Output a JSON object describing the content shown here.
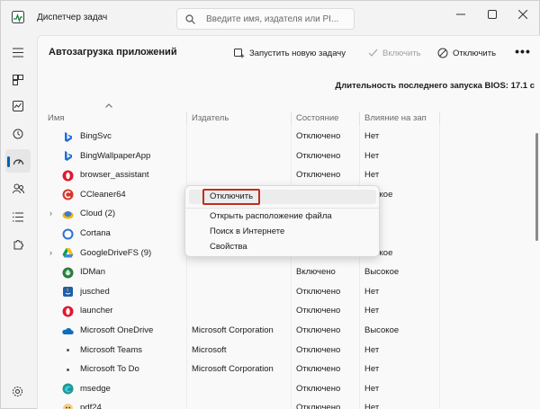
{
  "window": {
    "title": "Диспетчер задач",
    "search_placeholder": "Введите имя, издателя или PI..."
  },
  "page": {
    "title": "Автозагрузка приложений",
    "bios_label": "Длительность последнего запуска BIOS: 17.1 с"
  },
  "toolbar": {
    "run_new_task": "Запустить новую задачу",
    "enable": "Включить",
    "disable": "Отключить",
    "more": "•••"
  },
  "columns": {
    "name": "Имя",
    "publisher": "Издатель",
    "status": "Состояние",
    "impact": "Влияние на зап"
  },
  "rows": [
    {
      "name": "BingSvc",
      "publisher": "",
      "status": "Отключено",
      "impact": "Нет",
      "icon": "bing-icon",
      "expander": ""
    },
    {
      "name": "BingWallpaperApp",
      "publisher": "",
      "status": "Отключено",
      "impact": "Нет",
      "icon": "bing-icon",
      "expander": ""
    },
    {
      "name": "browser_assistant",
      "publisher": "",
      "status": "Отключено",
      "impact": "Нет",
      "icon": "opera-icon",
      "expander": ""
    },
    {
      "name": "CCleaner64",
      "publisher": "",
      "status": "Включено",
      "impact": "Низкое",
      "icon": "ccleaner-icon",
      "expander": ""
    },
    {
      "name": "Cloud (2)",
      "publisher": "",
      "status": "",
      "impact": "",
      "icon": "cloud-icon",
      "expander": "›"
    },
    {
      "name": "Cortana",
      "publisher": "",
      "status": "",
      "impact": "",
      "icon": "cortana-icon",
      "expander": ""
    },
    {
      "name": "GoogleDriveFS (9)",
      "publisher": "",
      "status": "",
      "impact": "Низкое",
      "icon": "google-drive-icon",
      "expander": "›"
    },
    {
      "name": "IDMan",
      "publisher": "",
      "status": "Включено",
      "impact": "Высокое",
      "icon": "idm-icon",
      "expander": ""
    },
    {
      "name": "jusched",
      "publisher": "",
      "status": "Отключено",
      "impact": "Нет",
      "icon": "java-icon",
      "expander": ""
    },
    {
      "name": "launcher",
      "publisher": "",
      "status": "Отключено",
      "impact": "Нет",
      "icon": "opera-icon",
      "expander": ""
    },
    {
      "name": "Microsoft OneDrive",
      "publisher": "Microsoft Corporation",
      "status": "Отключено",
      "impact": "Высокое",
      "icon": "onedrive-icon",
      "expander": ""
    },
    {
      "name": "Microsoft Teams",
      "publisher": "Microsoft",
      "status": "Отключено",
      "impact": "Нет",
      "icon": "teams-icon",
      "expander": ""
    },
    {
      "name": "Microsoft To Do",
      "publisher": "Microsoft Corporation",
      "status": "Отключено",
      "impact": "Нет",
      "icon": "todo-icon",
      "expander": ""
    },
    {
      "name": "msedge",
      "publisher": "",
      "status": "Отключено",
      "impact": "Нет",
      "icon": "edge-icon",
      "expander": ""
    },
    {
      "name": "pdf24",
      "publisher": "",
      "status": "Отключено",
      "impact": "Нет",
      "icon": "pdf24-icon",
      "expander": ""
    }
  ],
  "context_menu": {
    "disable": "Отключить",
    "open_location": "Открыть расположение файла",
    "search_online": "Поиск в Интернете",
    "properties": "Свойства"
  },
  "colors": {
    "accent": "#005fb8",
    "highlight_border": "#c42b1c"
  }
}
